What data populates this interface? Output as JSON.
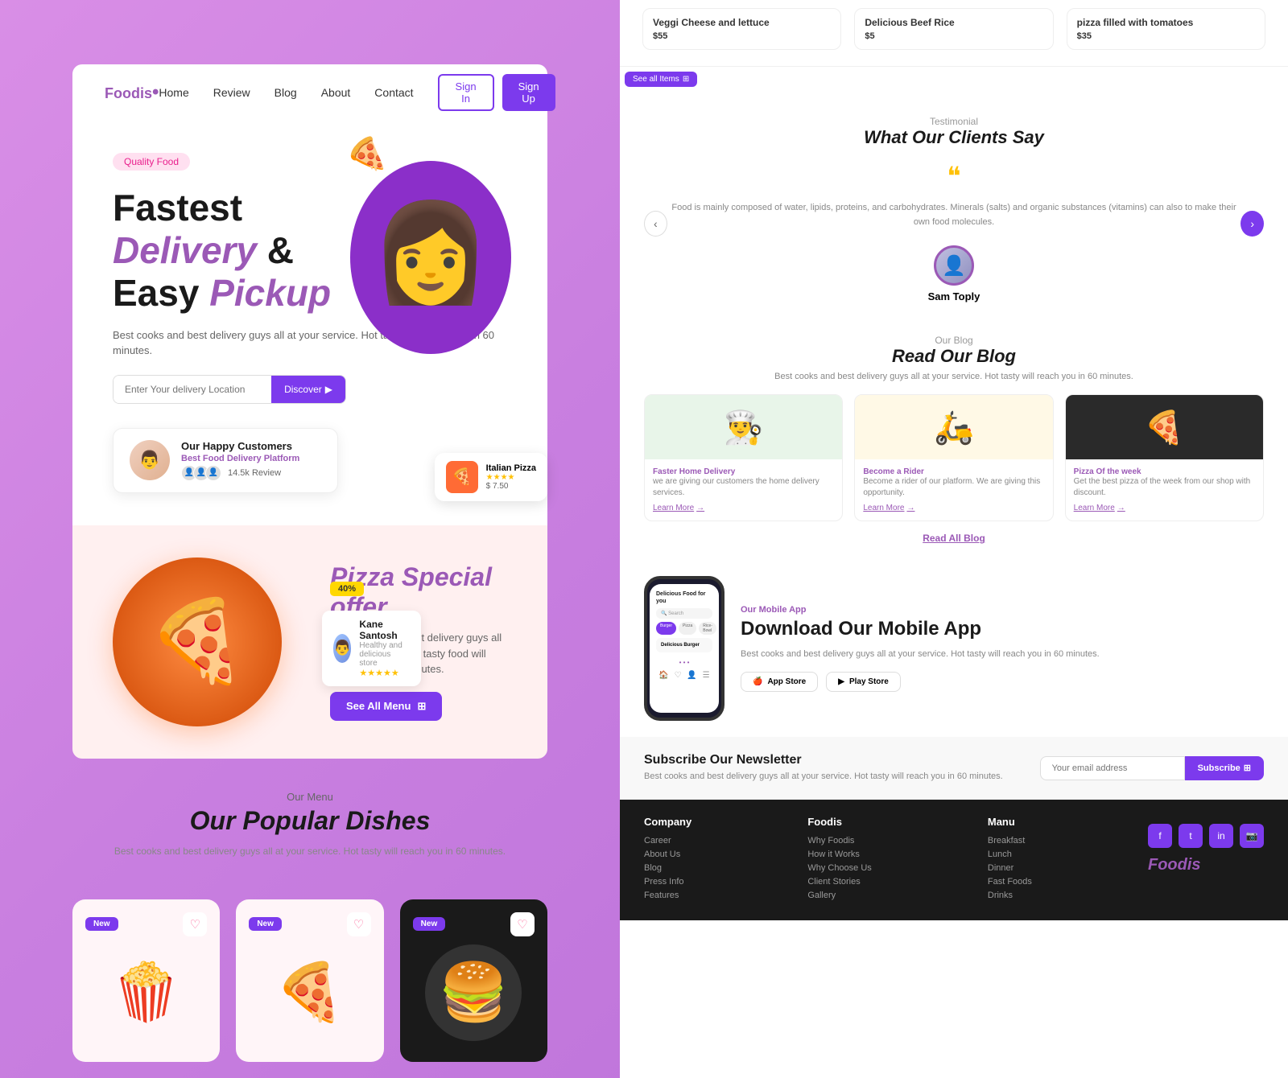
{
  "nav": {
    "logo": "Foodis",
    "links": [
      "Home",
      "Review",
      "Blog",
      "About",
      "Contact"
    ],
    "signin": "Sign In",
    "signup": "Sign Up"
  },
  "hero": {
    "quality_badge": "Quality Food",
    "title_line1": "Fastest",
    "title_line2": "Delivery &",
    "title_line3_start": "Easy ",
    "title_line3_end": "Pickup",
    "subtitle": "Best cooks and best delivery guys all at your service.\nHot tasty will reach you in 60 minutes.",
    "search_placeholder": "Enter Your delivery Location",
    "discover_btn": "Discover",
    "customers": {
      "name": "Our Happy Customers",
      "platform": "Best Food Delivery Platform",
      "reviews": "14.5k Review"
    },
    "pizza_card": {
      "name": "Italian Pizza",
      "price": "$ 7.50",
      "stars": "★★★★"
    }
  },
  "special_offer": {
    "badge": "40%",
    "title": "Pizza Special offer",
    "desc": "Best cooks and best delivery guys all at your service. Hot tasty food will reach you in 60 minutes.",
    "btn": "See All Menu",
    "reviewer": {
      "name": "Kane Santosh",
      "desc": "Healthy and delicious store",
      "stars": "★★★★★"
    }
  },
  "menu": {
    "sub": "Our Menu",
    "title": "Our Popular Dishes",
    "desc": "Best cooks and best delivery guys all at your service.\nHot tasty will reach you in 60 minutes.",
    "dishes": [
      {
        "badge": "New",
        "emoji": "🍿",
        "bg": "#fff5f8"
      },
      {
        "badge": "New",
        "emoji": "🍕",
        "bg": "#fff5f8"
      },
      {
        "badge": "New",
        "emoji": "🍔",
        "bg": "#1a1a1a"
      }
    ]
  },
  "top_cards": [
    {
      "name": "Veggi Cheese and lettuce",
      "price": "$55",
      "desc": ""
    },
    {
      "name": "Delicious Beef Rice",
      "price": "$5",
      "desc": ""
    },
    {
      "name": "pizza filled with tomatoes",
      "price": "$35",
      "desc": ""
    }
  ],
  "see_all": "See all Items",
  "testimonial": {
    "sub": "Testimonial",
    "title": "What Our Clients Say",
    "text": "Food is mainly composed of water, lipids, proteins, and carbohydrates. Minerals (salts) and organic substances (vitamins) can also to make their own food molecules.",
    "reviewer": {
      "name": "Sam Toply"
    }
  },
  "blog": {
    "sub": "Our Blog",
    "title": "Read Our Blog",
    "desc": "Best cooks and best delivery guys all at your service.\nHot tasty will reach you in 60 minutes.",
    "posts": [
      {
        "cat": "Faster Home Delivery",
        "name": "Faster Home Delivery",
        "desc": "we are giving our customers the home delivery services.",
        "link": "Learn More",
        "emoji": "👨‍🍳",
        "bg": "green"
      },
      {
        "cat": "Become a Rider",
        "name": "Become a Rider",
        "desc": "Become a rider of our platform. We are giving this opportunity.",
        "link": "Learn More",
        "emoji": "🛵",
        "bg": "yellow"
      },
      {
        "cat": "Pizza Of the week",
        "name": "Pizza Of the week",
        "desc": "Get the best pizza of the week from our shop with discount.",
        "link": "Learn More",
        "emoji": "🍕",
        "bg": "dark"
      }
    ],
    "read_all": "Read All Blog"
  },
  "mobile_app": {
    "sub": "Our Mobile App",
    "title": "Download Our Mobile App",
    "desc": "Best cooks and best delivery guys all at your service.\nHot tasty will reach you in 60 minutes.",
    "app_store": "App Store",
    "play_store": "Play Store",
    "phone": {
      "header": "Delicious Food for you",
      "search": "🔍 Search",
      "tabs": [
        "Burger",
        "Pizza",
        "Rice-Bowl"
      ],
      "item": "Delicious Burger"
    }
  },
  "newsletter": {
    "title": "Subscribe Our Newsletter",
    "desc": "Best cooks and best delivery guys all at your service.\nHot tasty will reach you in 60 minutes.",
    "placeholder": "Your email address",
    "btn": "Subscribe"
  },
  "footer": {
    "columns": [
      {
        "title": "Company",
        "links": [
          "Career",
          "About Us",
          "Blog",
          "Press Info",
          "Features"
        ]
      },
      {
        "title": "Foodis",
        "links": [
          "Why Foodis",
          "How it Works",
          "Why Choose Us",
          "Client Stories",
          "Gallery"
        ]
      },
      {
        "title": "Manu",
        "links": [
          "Breakfast",
          "Lunch",
          "Dinner",
          "Fast Foods",
          "Drinks"
        ]
      }
    ],
    "social": [
      "f",
      "t",
      "in",
      "📷"
    ],
    "logo": "Foodis"
  },
  "colors": {
    "purple": "#7c3aed",
    "light_purple": "#9b59b6",
    "accent_yellow": "#ffc107",
    "bg_pink": "#fff0f0"
  }
}
